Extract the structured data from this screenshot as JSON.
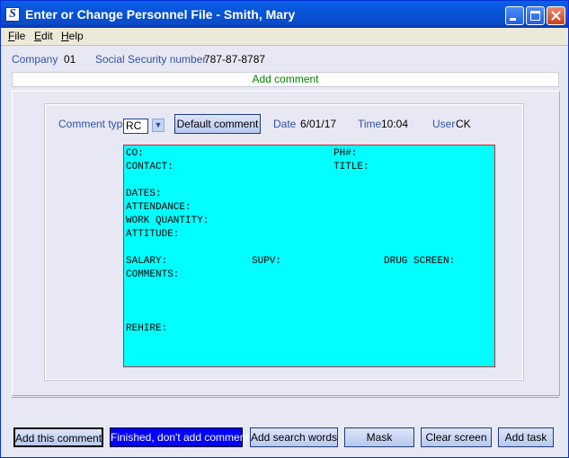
{
  "window": {
    "title": "Enter or Change Personnel File - Smith, Mary",
    "app_icon_letter": "S"
  },
  "menu": {
    "items": [
      {
        "underline": "F",
        "rest": "ile"
      },
      {
        "underline": "E",
        "rest": "dit"
      },
      {
        "underline": "H",
        "rest": "elp"
      }
    ]
  },
  "info": {
    "company_label": "Company",
    "company_value": "01",
    "ssn_label": "Social Security number",
    "ssn_value": "787-87-8787"
  },
  "section_title": "Add comment",
  "comment_header": {
    "type_label": "Comment type",
    "type_value": "RC",
    "default_button": "Default comment",
    "date_label": "Date",
    "date_value": "6/01/17",
    "time_label": "Time",
    "time_value": "10:04",
    "user_label": "User",
    "user_value": "CK"
  },
  "comment_lines": [
    "CO:",
    "PH#:",
    "CONTACT:",
    "TITLE:",
    "DATES:",
    "ATTENDANCE:",
    "WORK QUANTITY:",
    "ATTITUDE:",
    "SALARY:",
    "SUPV:",
    "DRUG SCREEN:",
    "COMMENTS:",
    "REHIRE:"
  ],
  "buttons": {
    "add_this_comment": "Add this comment",
    "finished": "Finished, don't add comment",
    "add_search_words": "Add search words",
    "mask": "Mask",
    "clear_screen": "Clear screen",
    "add_task": "Add task"
  },
  "colors": {
    "title_bar": "#0754D8",
    "comment_bg": "#00FFFF",
    "label_blue": "#3153A8",
    "section_green": "#008000",
    "finished_button": "#0000FF"
  }
}
